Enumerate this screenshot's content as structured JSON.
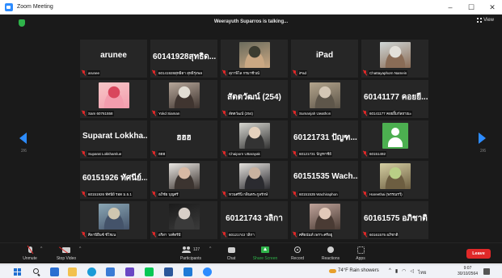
{
  "window": {
    "title": "Zoom Meeting",
    "controls": [
      "–",
      "☐",
      "✕"
    ]
  },
  "meeting": {
    "talking_text": "Weerayuth Suparros is talking...",
    "view_label": "View",
    "page_indicator_left": "2/6",
    "page_indicator_right": "2/6"
  },
  "tiles": [
    {
      "big": "arunee",
      "label": "arunee",
      "photo": null
    },
    {
      "big": "60141928สุทธิด...",
      "label": "60141928สุทธิดา สุทธิรุ่งพล",
      "photo": null
    },
    {
      "big": "",
      "label": "สุภาพิไล กรมาชีวณ์",
      "photo": {
        "colors": [
          "#6b6b5c",
          "#caa883",
          "#3c3c30"
        ]
      }
    },
    {
      "big": "iPad",
      "label": "iPad",
      "photo": null
    },
    {
      "big": "",
      "label": "Chattayaphorn Namein",
      "photo": {
        "colors": [
          "#cfd6d6",
          "#8a6c56",
          "#e3e0da"
        ]
      }
    },
    {
      "big": "",
      "label": "Sam 60761558",
      "photo": {
        "colors": [
          "#f7c6c7",
          "#f39dae",
          "#d9465d"
        ]
      }
    },
    {
      "big": "",
      "label": "Yokd Siaman",
      "photo": {
        "colors": [
          "#b6a79a",
          "#403530",
          "#e2ddd4"
        ]
      }
    },
    {
      "big": "สัตตวัฒน์ (254)",
      "label": "สัตตวัฒน์ (254)",
      "photo": null
    },
    {
      "big": "",
      "label": "Sumanjah Uwathon",
      "photo": {
        "colors": [
          "#b3a48c",
          "#5e564a",
          "#d4c7b5"
        ]
      }
    },
    {
      "big": "60141177 คอยยี...",
      "label": "60141177 คอยยิ้มกัลยาณะ",
      "photo": null
    },
    {
      "big": "Suparat Lokkha...",
      "label": "Suparat Lokkhamlue",
      "photo": null
    },
    {
      "big": "ฮฮฮ",
      "label": "ฮฮฮ",
      "photo": null
    },
    {
      "big": "",
      "label": "Chaiporn Uttarayak",
      "photo": {
        "colors": [
          "#d6d6d0",
          "#333333",
          "#e4d1bd"
        ]
      }
    },
    {
      "big": "60121731 ปัญฑ...",
      "label": "60121731 ปัญฑาชีย์",
      "photo": null
    },
    {
      "big": "",
      "label": "60151492",
      "photo": "generic"
    },
    {
      "big": "60151926 ทัศนีย์...",
      "label": "60151926 ทัศนีย์ รอด ม.5.1",
      "photo": null
    },
    {
      "big": "",
      "label": "อภิชัย บุญศรี",
      "photo": {
        "colors": [
          "#e9e6e2",
          "#3c3430",
          "#d8b9a4"
        ]
      }
    },
    {
      "big": "",
      "label": "ทวนศรีนิ กลินตระกูลรักษ์",
      "photo": {
        "colors": [
          "#e4e1dd",
          "#2b2b30",
          "#c9b2a0"
        ]
      }
    },
    {
      "big": "60151535 Wach...",
      "label": "60151535 Wachiraphon",
      "photo": null
    },
    {
      "big": "",
      "label": "Hareethai (พรรณรวี)",
      "photo": {
        "colors": [
          "#d5cfa3",
          "#6d5e41",
          "#b9cf86"
        ]
      }
    },
    {
      "big": "",
      "label": "ศิลาปียืนซ์ ชีโชเน",
      "photo": {
        "colors": [
          "#8aa6b4",
          "#44536a",
          "#cfc6b0"
        ]
      }
    },
    {
      "big": "",
      "label": "อริสา วงศ์ตรีมี",
      "photo": {
        "colors": [
          "#1b1b1b",
          "#3a3a3a",
          "#d8cfc8"
        ]
      }
    },
    {
      "big": "60121743 วลิกา",
      "label": "60121743 วลิกา",
      "photo": null
    },
    {
      "big": "",
      "label": "ศศิธนันท์ เพราะศรีอยู่",
      "photo": {
        "colors": [
          "#bfa39a",
          "#4a3b34",
          "#e2c9b9"
        ]
      }
    },
    {
      "big": "60161575 อภิชาติ",
      "label": "60161575 อภิชาติ",
      "photo": null
    }
  ],
  "toolbar": {
    "unmute": "Unmute",
    "stop_video": "Stop Video",
    "participants": "Participants",
    "participants_count": "127",
    "chat": "Chat",
    "share_screen": "Share Screen",
    "record": "Record",
    "reactions": "Reactions",
    "apps": "Apps",
    "leave": "Leave"
  },
  "taskbar": {
    "weather": "74°F Rain showers",
    "tray_lang": "ไทย",
    "time": "9:07",
    "date": "30/10/2564"
  },
  "colors": {
    "zoom_blue": "#2d8cff",
    "leave_red": "#e02828",
    "share_green": "#2fb34a",
    "meeting_bg": "#1a1a1a",
    "tile_bg": "#262626"
  }
}
